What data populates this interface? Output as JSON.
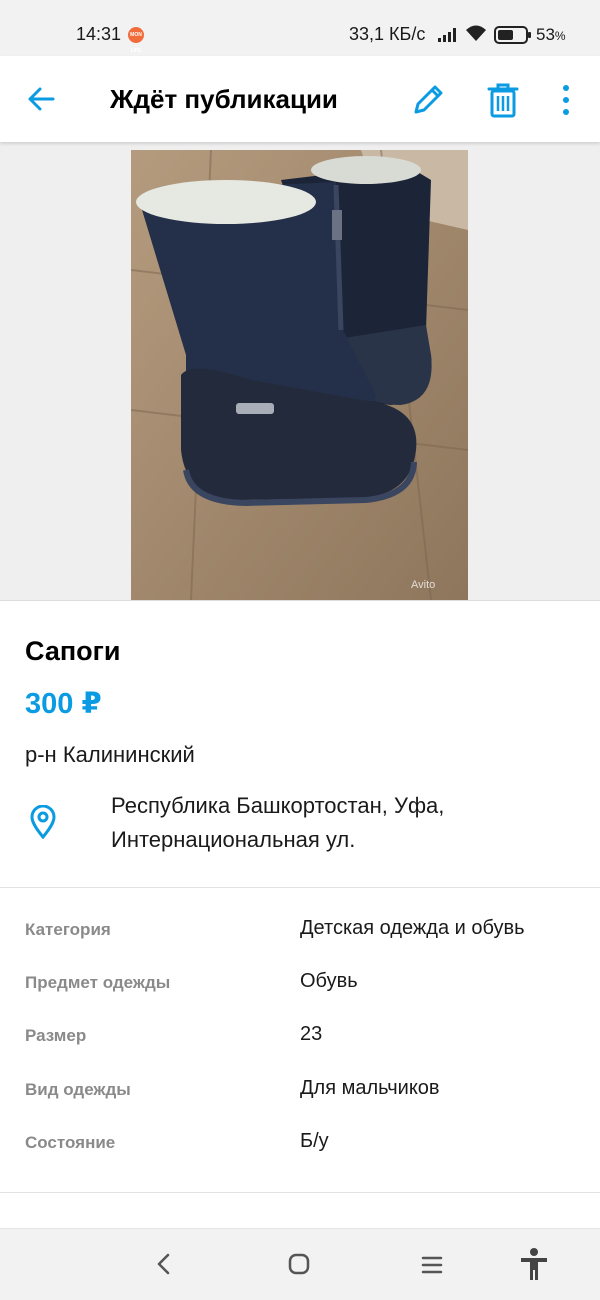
{
  "status_bar": {
    "time": "14:31",
    "app_badge": "MON LIFE",
    "network_speed": "33,1 КБ/с",
    "battery_percent": "53",
    "battery_unit": "%",
    "icons": [
      "signal-icon",
      "wifi-icon",
      "battery-icon"
    ]
  },
  "app_bar": {
    "title": "Ждёт публикации",
    "actions": [
      "back-arrow-icon",
      "pencil-icon",
      "trash-icon",
      "more-vertical-icon"
    ],
    "accent_color": "#0a9be3"
  },
  "photo": {
    "watermark": "Avito",
    "description_icon": "boot-photo"
  },
  "listing": {
    "title": "Сапоги",
    "price": "300 ₽",
    "district": "р-н Калининский",
    "address_line1": "Республика Башкортостан, Уфа,",
    "address_line2": "Интернациональная ул."
  },
  "params": [
    {
      "label": "Категория",
      "value": "Детская одежда и обувь"
    },
    {
      "label": "Предмет одежды",
      "value": "Обувь"
    },
    {
      "label": "Размер",
      "value": "23"
    },
    {
      "label": "Вид одежды",
      "value": "Для мальчиков"
    },
    {
      "label": "Состояние",
      "value": "Б/у"
    }
  ],
  "nav_bar": {
    "icons": [
      "back-chevron-icon",
      "home-icon",
      "recents-icon",
      "accessibility-icon"
    ]
  }
}
